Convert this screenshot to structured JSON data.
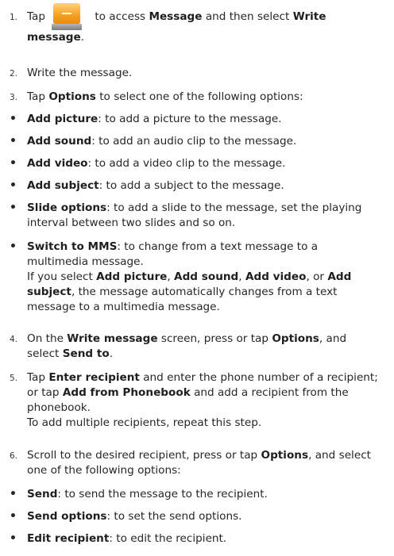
{
  "steps": [
    {
      "num": "1.",
      "tap": "Tap",
      "icon": "message-app-icon",
      "rest1": " to access ",
      "b1": "Message",
      "rest2": " and then select ",
      "b2": "Write message",
      "rest3": "."
    },
    {
      "num": "2.",
      "text": "Write the message."
    },
    {
      "num": "3.",
      "pre": "Tap ",
      "bold": "Options",
      "post": " to select one of the following options:"
    }
  ],
  "options_list": [
    {
      "bold": "Add picture",
      "text": ": to add a picture to the message."
    },
    {
      "bold": "Add sound",
      "text": ": to add an audio clip to the message."
    },
    {
      "bold": "Add video",
      "text": ": to add a video clip to the message."
    },
    {
      "bold": "Add subject",
      "text": ": to add a subject to the message."
    },
    {
      "bold": "Slide options",
      "text": ": to add a slide to the message, set the playing interval between two slides and so on."
    },
    {
      "bold": "Switch to MMS",
      "text": ": to change from a text message to a multimedia message."
    }
  ],
  "mms_note": {
    "t1": "If you select ",
    "b1": "Add picture",
    "t2": ", ",
    "b2": "Add sound",
    "t3": ", ",
    "b3": "Add video",
    "t4": ", or ",
    "b4": "Add subject",
    "t5": ", the message automatically changes from a text message to a multimedia message."
  },
  "step4": {
    "num": "4.",
    "t1": "On the ",
    "b1": "Write message",
    "t2": " screen, press or tap ",
    "b2": "Options",
    "t3": ", and select ",
    "b3": "Send to",
    "t4": "."
  },
  "step5": {
    "num": "5.",
    "t1": "Tap ",
    "b1": "Enter recipient",
    "t2": " and enter the phone number of a recipient; or tap ",
    "b2": "Add from Phonebook",
    "t3": " and add a recipient from the phonebook.",
    "note": "To add multiple recipients, repeat this step."
  },
  "step6": {
    "num": "6.",
    "t1": "Scroll to the desired recipient, press or tap ",
    "b1": "Options",
    "t2": ", and select one of the following options:"
  },
  "recipient_options": [
    {
      "bold": "Send",
      "text": ": to send the message to the recipient."
    },
    {
      "bold": "Send options",
      "text": ": to set the send options."
    },
    {
      "bold": "Edit recipient",
      "text": ": to edit the recipient."
    }
  ]
}
